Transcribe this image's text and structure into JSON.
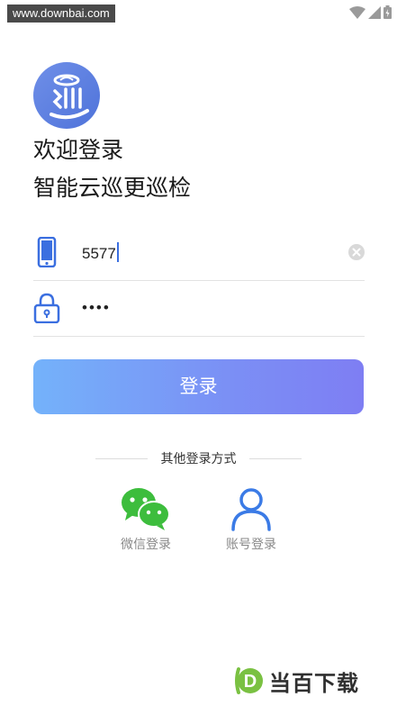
{
  "statusbar": {
    "watermark_text": "www.downbai.com",
    "icons": [
      "wifi-icon",
      "signal-icon",
      "battery-icon"
    ]
  },
  "header": {
    "welcome": "欢迎登录",
    "app_name": "智能云巡更巡检"
  },
  "form": {
    "phone": {
      "icon": "phone-icon",
      "value": "5577"
    },
    "password": {
      "icon": "lock-icon",
      "masked_value": "••••"
    }
  },
  "login_button": {
    "label": "登录"
  },
  "other_methods": {
    "heading": "其他登录方式",
    "options": [
      {
        "icon": "wechat-icon",
        "label": "微信登录"
      },
      {
        "icon": "user-icon",
        "label": "账号登录"
      }
    ]
  },
  "brand_watermark": {
    "text": "当百下载",
    "mark_letter": "D"
  },
  "colors": {
    "accent": "#3b6fe0",
    "button_gradient_start": "#74b2fa",
    "button_gradient_end": "#7e7ef3",
    "wechat_green": "#3dbd3d",
    "text_dark": "#1a1a1a",
    "text_muted": "#888888"
  }
}
